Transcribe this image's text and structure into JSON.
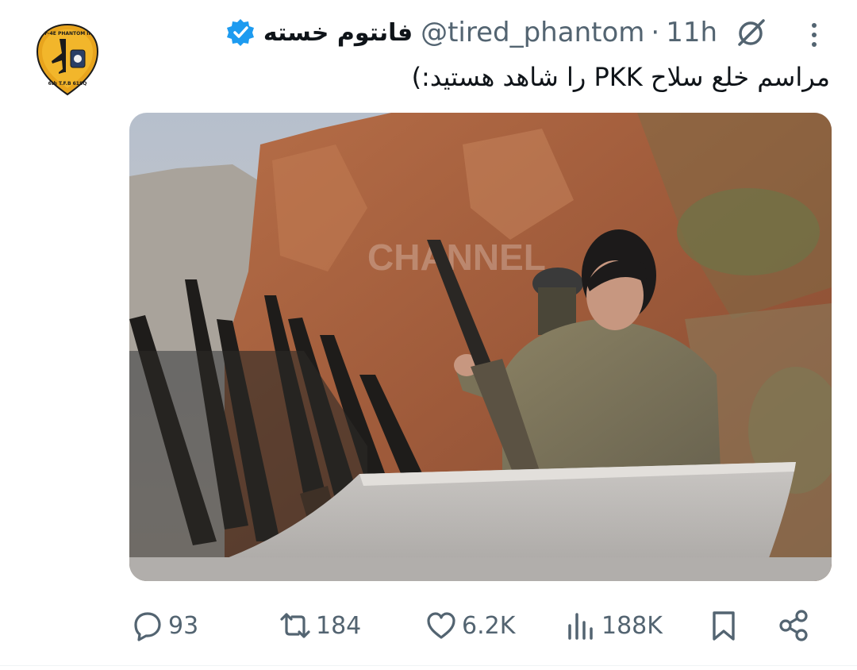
{
  "author": {
    "display_name": "فانتوم خسته",
    "handle": "@tired_phantom",
    "separator": "·",
    "time": "11h",
    "avatar_text": "F-4E PHANTOM II",
    "avatar_subtext": "6th T.F.B 61SQ"
  },
  "tweet": {
    "text": "مراسم خلع سلاح PKK را شاهد هستید:)"
  },
  "media": {
    "watermark": "CHANNEL"
  },
  "actions": {
    "replies": "93",
    "reposts": "184",
    "likes": "6.2K",
    "views": "188K"
  },
  "colors": {
    "verified": "#1d9bf0",
    "muted_text": "#536471",
    "primary_text": "#0f1419"
  }
}
